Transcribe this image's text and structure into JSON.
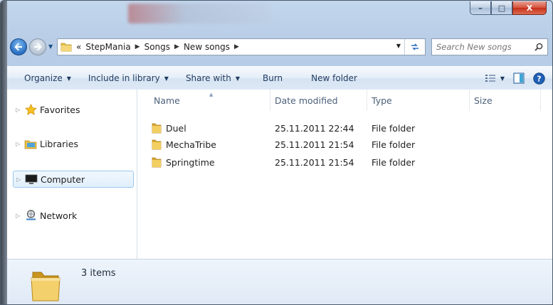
{
  "window": {
    "accent": "#2a6fc2",
    "close_color": "#c5301a",
    "caption": {
      "minimize": "–",
      "maximize": "□",
      "close": "X"
    }
  },
  "address": {
    "overflow": "«",
    "crumbs": [
      "StepMania",
      "Songs",
      "New songs"
    ]
  },
  "search": {
    "placeholder": "Search New songs"
  },
  "toolbar": {
    "organize": "Organize",
    "include_in_library": "Include in library",
    "share_with": "Share with",
    "burn": "Burn",
    "new_folder": "New folder"
  },
  "nav_pane": {
    "items": [
      {
        "label": "Favorites",
        "icon": "star-icon"
      },
      {
        "label": "Libraries",
        "icon": "library-icon"
      },
      {
        "label": "Computer",
        "icon": "computer-icon",
        "selected": true
      },
      {
        "label": "Network",
        "icon": "network-icon"
      }
    ]
  },
  "file_list": {
    "columns": [
      "Name",
      "Date modified",
      "Type",
      "Size"
    ],
    "rows": [
      {
        "name": "Duel",
        "date": "25.11.2011 22:44",
        "type": "File folder",
        "size": ""
      },
      {
        "name": "MechaTribe",
        "date": "25.11.2011 21:54",
        "type": "File folder",
        "size": ""
      },
      {
        "name": "Springtime",
        "date": "25.11.2011 21:54",
        "type": "File folder",
        "size": ""
      }
    ]
  },
  "details": {
    "item_count": "3 items"
  }
}
